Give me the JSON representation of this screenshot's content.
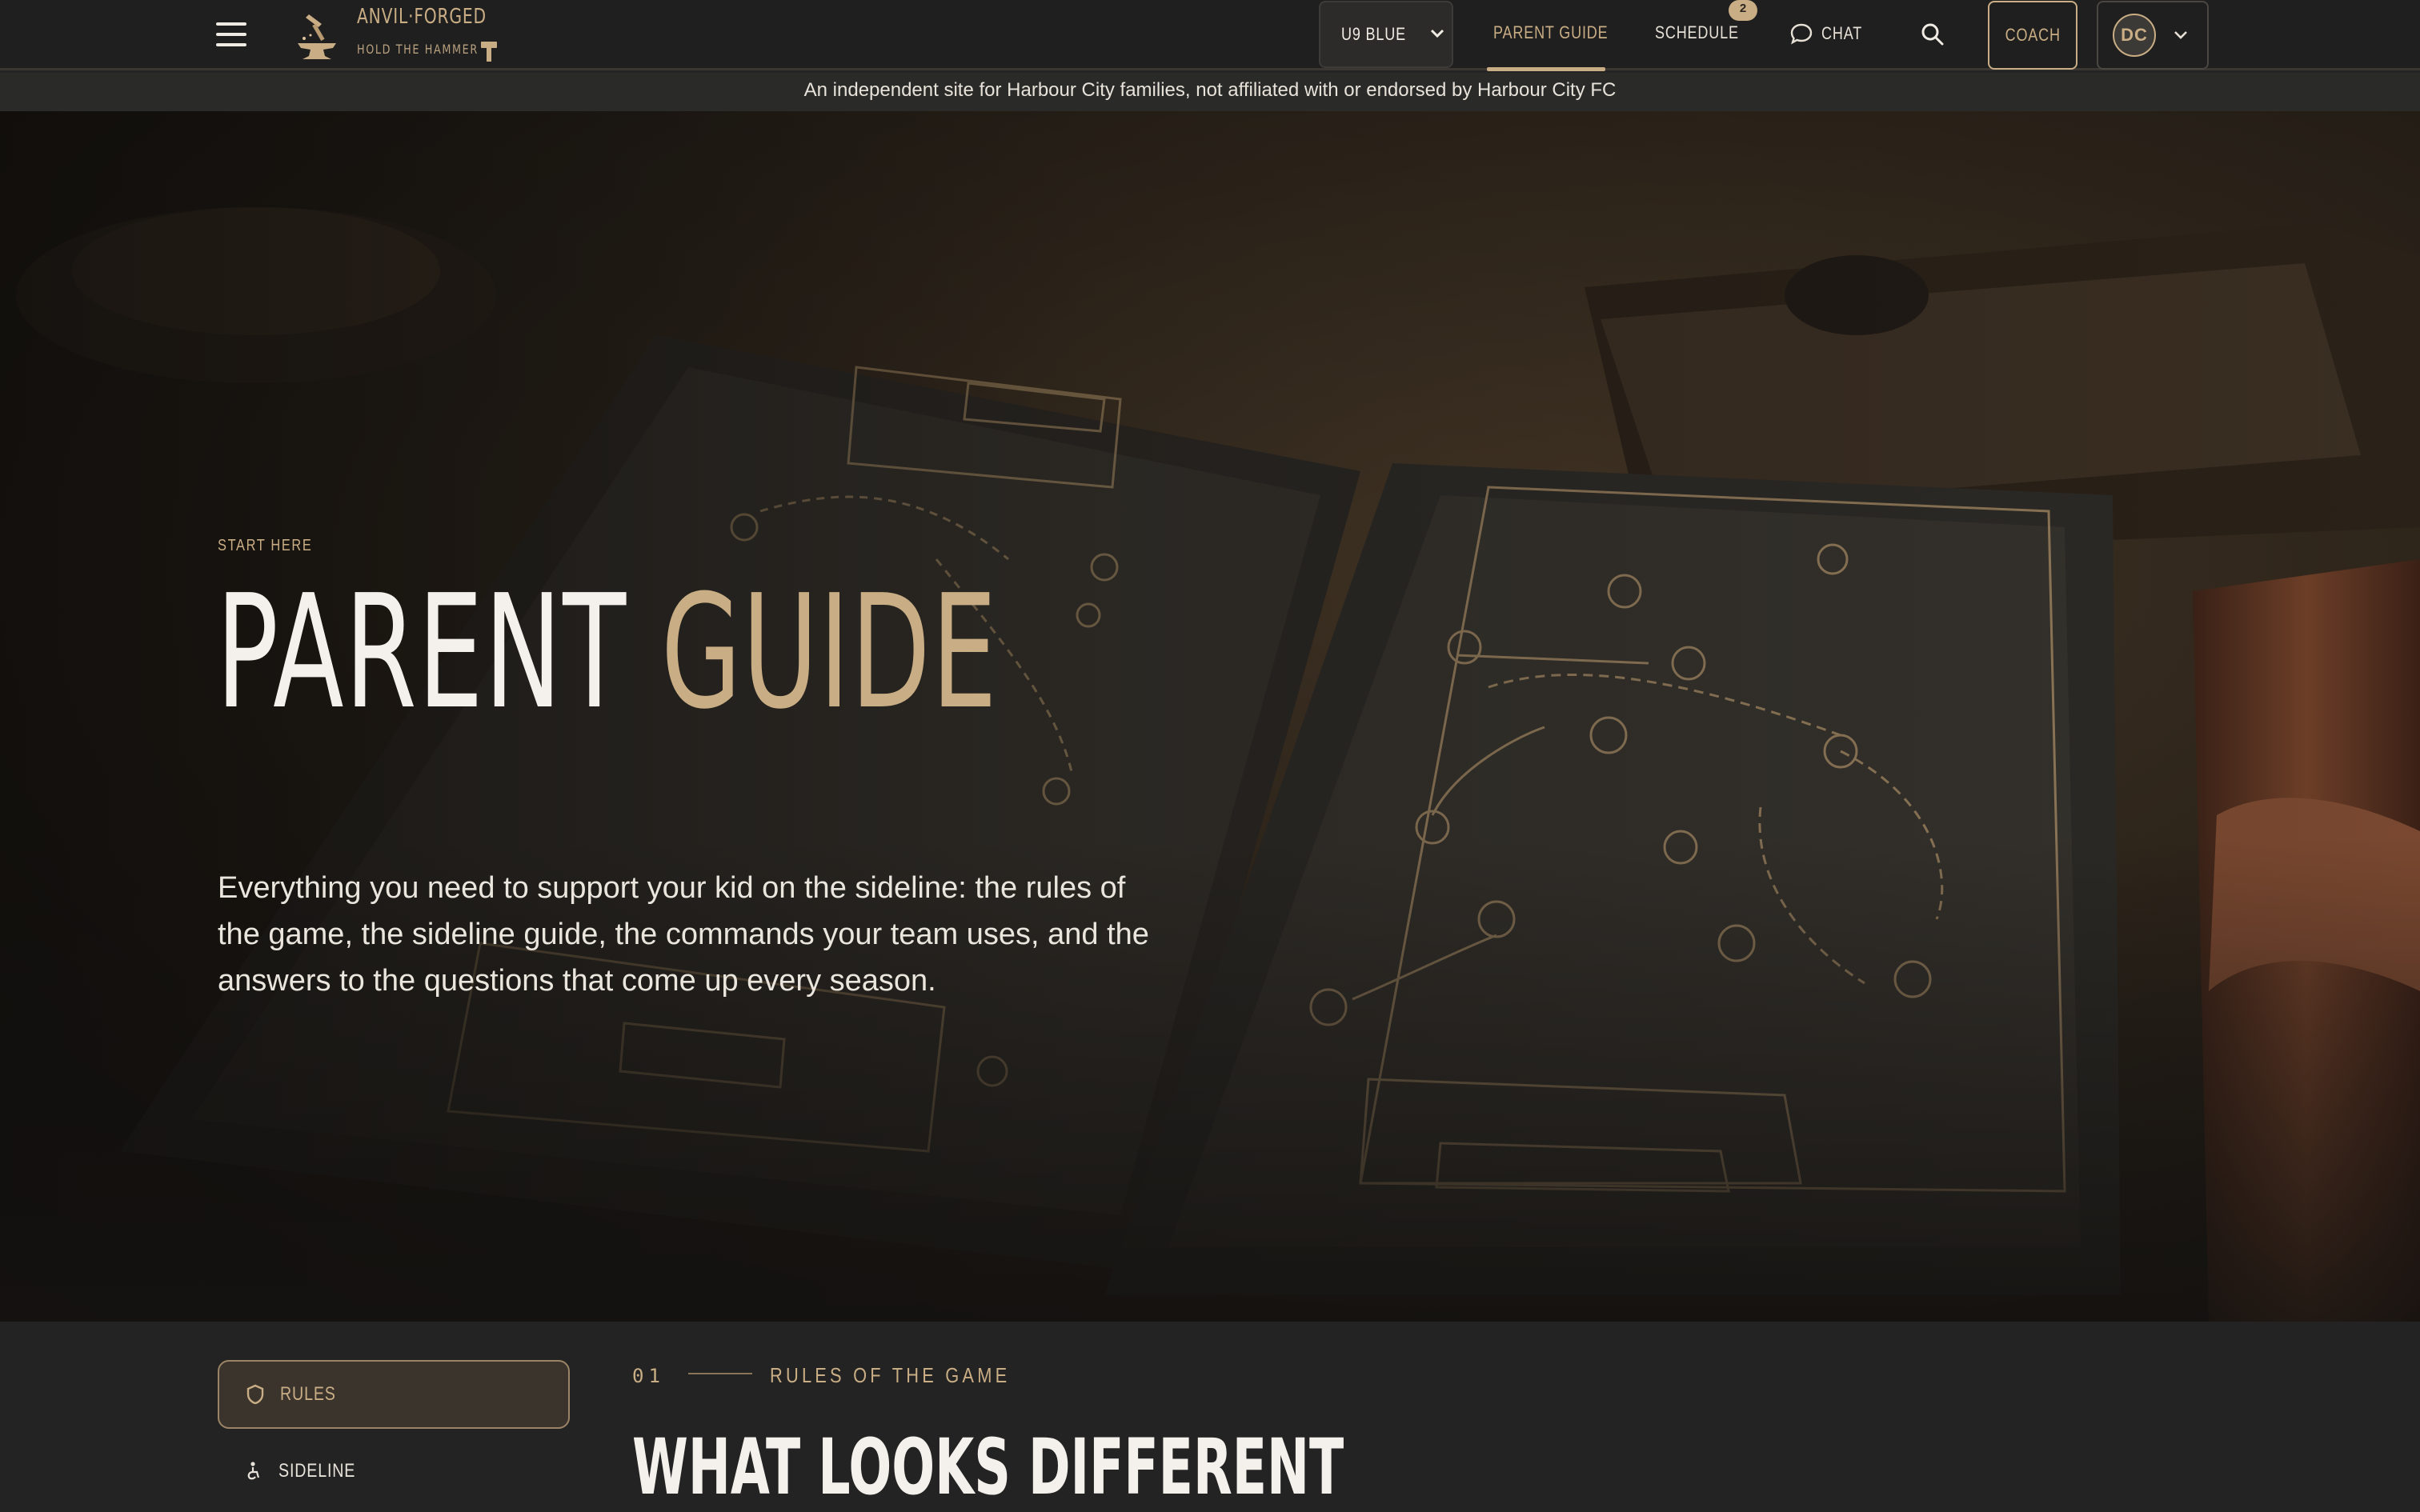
{
  "nav": {
    "brand_name": "ANVIL·FORGED",
    "brand_tagline": "HOLD THE HAMMER",
    "team_select": "U9 BLUE",
    "links": {
      "parent_guide": "PARENT GUIDE",
      "schedule": "SCHEDULE",
      "chat": "CHAT"
    },
    "schedule_badge": "2",
    "coach_button": "COACH",
    "user_initials": "DC"
  },
  "disclaimer": "An independent site for Harbour City families, not affiliated with or endorsed by Harbour City FC",
  "hero": {
    "eyebrow": "START HERE",
    "title_part1": "PARENT",
    "title_part2": "GUIDE",
    "subtitle": "Everything you need to support your kid on the sideline: the rules of the game, the sideline guide, the commands your team uses, and the answers to the questions that come up every season."
  },
  "sidebar": {
    "items": [
      {
        "label": "RULES",
        "icon": "shield-icon",
        "active": true
      },
      {
        "label": "SIDELINE",
        "icon": "person-standing-icon",
        "active": false
      }
    ]
  },
  "section": {
    "number": "01",
    "label": "RULES OF THE GAME",
    "title": "WHAT LOOKS DIFFERENT"
  },
  "colors": {
    "accent_gold": "#c9ad84",
    "nav_bg": "#1f1f1f",
    "page_bg": "#232323"
  }
}
